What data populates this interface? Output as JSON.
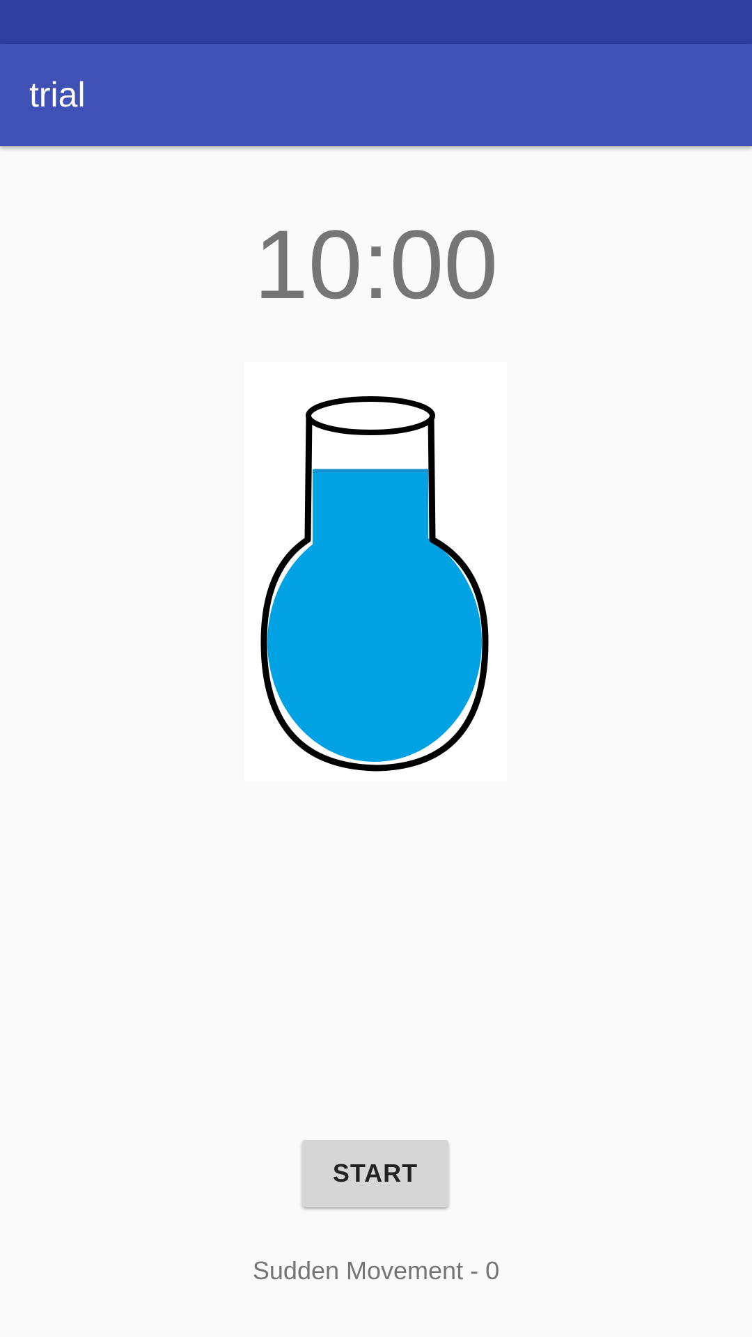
{
  "app_bar": {
    "title": "trial",
    "color": "#3f51b5",
    "status_bar_color": "#303f9f"
  },
  "timer": {
    "text": "10:00"
  },
  "flask": {
    "icon": "flask-icon",
    "liquid_color": "#00a2e4"
  },
  "controls": {
    "start_label": "START"
  },
  "status": {
    "movement_text": "Sudden Movement - 0"
  }
}
